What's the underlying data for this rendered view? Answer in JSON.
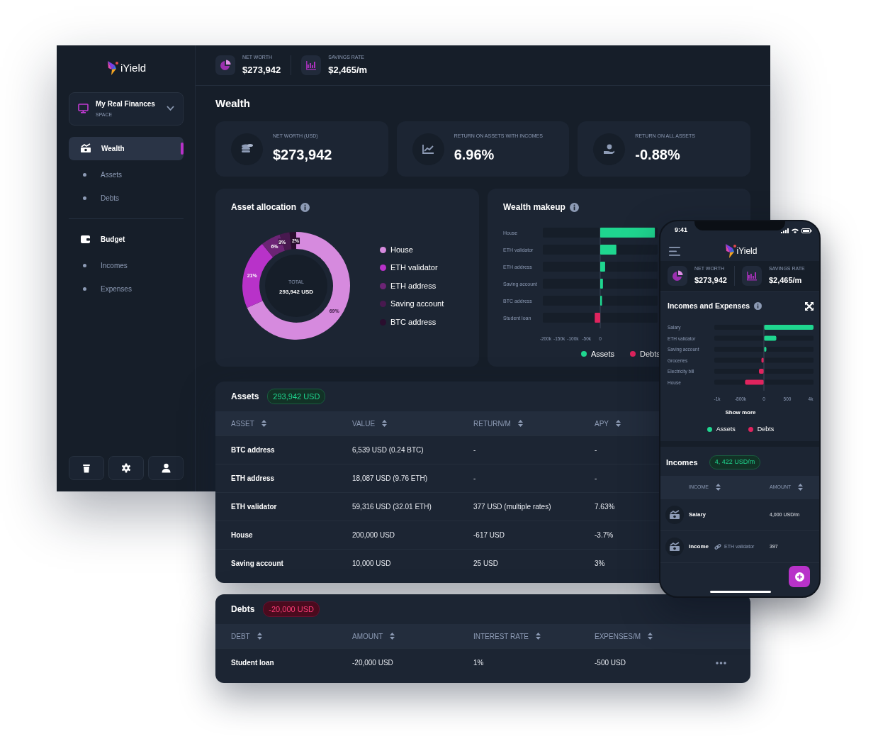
{
  "sidebar": {
    "logo": "iYield",
    "space": {
      "name": "My Real Finances",
      "label": "SPACE",
      "expanded": false
    },
    "nav_groups": [
      {
        "items": [
          {
            "label": "Wealth",
            "kind": "section",
            "selected": true
          },
          {
            "label": "Assets",
            "kind": "sub",
            "selected": false
          },
          {
            "label": "Debts",
            "kind": "sub",
            "selected": false
          }
        ]
      },
      {
        "items": [
          {
            "label": "Budget",
            "kind": "section",
            "selected": false
          },
          {
            "label": "Incomes",
            "kind": "sub",
            "selected": false
          },
          {
            "label": "Expenses",
            "kind": "sub",
            "selected": false
          }
        ]
      }
    ]
  },
  "header_stats": [
    {
      "kind": "pie",
      "label": "NET WORTH",
      "value": "$273,942"
    },
    {
      "kind": "bars",
      "label": "SAVINGS RATE",
      "value": "$2,465/m"
    }
  ],
  "page_title": "Wealth",
  "kpis": [
    {
      "kind": "coins",
      "label": "NET WORTH (USD)",
      "value": "$273,942"
    },
    {
      "kind": "chart",
      "label": "RETURN ON ASSETS WITH INCOMES",
      "value": "6.96%"
    },
    {
      "kind": "hand",
      "label": "RETURN ON ALL ASSETS",
      "value": "-0.88%"
    }
  ],
  "allocation": {
    "title": "Asset allocation",
    "total_label": "TOTAL",
    "total_value": "293,942 USD",
    "chart_data": {
      "type": "donut",
      "categories": [
        "House",
        "ETH validator",
        "ETH address",
        "Saving account",
        "BTC address"
      ],
      "values": [
        69,
        21,
        6,
        3,
        2
      ],
      "colors": [
        "#d68ade",
        "#b832c9",
        "#6c2475",
        "#48194f",
        "#2a0e2e"
      ],
      "value_labels": [
        "69%",
        "21%",
        "6%",
        "3%",
        "2%"
      ]
    }
  },
  "makeup": {
    "title": "Wealth makeup",
    "chart_data": {
      "type": "bar",
      "orientation": "horizontal",
      "categories": [
        "House",
        "ETH validator",
        "ETH address",
        "Saving account",
        "BTC address",
        "Student loan"
      ],
      "series": [
        {
          "name": "Assets",
          "color": "#1fd68f",
          "values": [
            200000,
            59000,
            18000,
            10000,
            6500,
            null
          ]
        },
        {
          "name": "Debts",
          "color": "#e0245e",
          "values": [
            null,
            null,
            null,
            null,
            null,
            -20000
          ]
        }
      ],
      "xlim": [
        -210000,
        210000
      ],
      "xticks": [
        {
          "value": -200000,
          "label": "-200k"
        },
        {
          "value": -150000,
          "label": "-150k"
        },
        {
          "value": -100000,
          "label": "-100k"
        },
        {
          "value": -50000,
          "label": "-50k"
        },
        {
          "value": 0,
          "label": "0"
        }
      ]
    }
  },
  "assets": {
    "title": "Assets",
    "total": "293,942 USD",
    "columns": [
      "ASSET",
      "VALUE",
      "RETURN/M",
      "APY"
    ],
    "rows": [
      [
        "BTC address",
        "6,539 USD (0.24 BTC)",
        "-",
        "-"
      ],
      [
        "ETH address",
        "18,087 USD (9.76 ETH)",
        "-",
        "-"
      ],
      [
        "ETH validator",
        "59,316 USD (32.01 ETH)",
        "377 USD (multiple rates)",
        "7.63%"
      ],
      [
        "House",
        "200,000 USD",
        "-617 USD",
        "-3.7%"
      ],
      [
        "Saving account",
        "10,000 USD",
        "25 USD",
        "3%"
      ]
    ]
  },
  "debts": {
    "title": "Debts",
    "total": "-20,000 USD",
    "columns": [
      "DEBT",
      "AMOUNT",
      "INTEREST RATE",
      "EXPENSES/M"
    ],
    "rows": [
      [
        "Student loan",
        "-20,000 USD",
        "1%",
        "-500 USD"
      ]
    ]
  },
  "phone": {
    "time": "9:41",
    "logo": "iYield",
    "stats": [
      {
        "kind": "pie",
        "label": "NET WORTH",
        "value": "$273,942"
      },
      {
        "kind": "bars",
        "label": "SAVINGS RATE",
        "value": "$2,465/m"
      }
    ],
    "chart_card": {
      "title": "Incomes and Expenses",
      "show_more": "Show more",
      "categories": [
        "Salary",
        "ETH validator",
        "Saving account",
        "Groceries",
        "Electricity bill",
        "House"
      ],
      "tick_labels": [
        "-1k",
        "-800k",
        "0",
        "500",
        "4k"
      ],
      "legend": [
        {
          "name": "Assets",
          "color": "#1fd68f"
        },
        {
          "name": "Debts",
          "color": "#e0245e"
        }
      ]
    },
    "incomes": {
      "title": "Incomes",
      "total": "4, 422 USD/m",
      "columns": [
        "INCOME",
        "AMOUNT"
      ],
      "rows": [
        {
          "name": "Salary",
          "amount": "4,000 USD/m"
        },
        {
          "name": "Income",
          "link": "ETH validator",
          "amount": "397"
        }
      ]
    }
  }
}
